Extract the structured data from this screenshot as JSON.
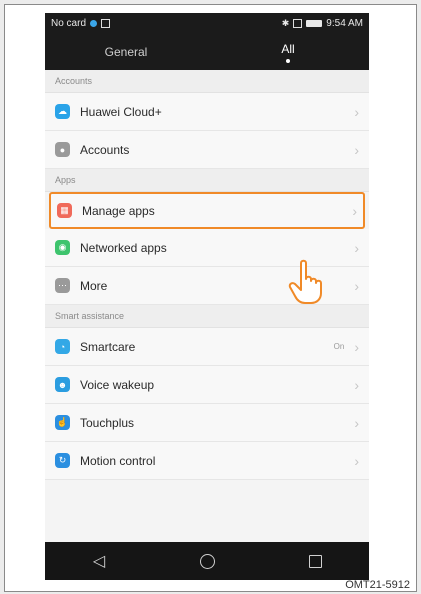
{
  "status_bar": {
    "left_text": "No card",
    "time": "9:54 AM",
    "icons": [
      "sim-icon",
      "bluetooth-icon",
      "battery-icon"
    ]
  },
  "tabs": [
    {
      "label": "General",
      "selected": false
    },
    {
      "label": "All",
      "selected": true
    }
  ],
  "sections": {
    "accounts": {
      "header": "Accounts",
      "items": [
        {
          "label": "Huawei Cloud+",
          "icon": "cloud-icon",
          "icon_color": "#2aa3e8"
        },
        {
          "label": "Accounts",
          "icon": "account-icon",
          "icon_color": "#9a9a9a"
        }
      ]
    },
    "apps": {
      "header": "Apps",
      "items": [
        {
          "label": "Manage apps",
          "icon": "apps-grid-icon",
          "icon_color": "#f06a5a",
          "highlighted": true
        },
        {
          "label": "Networked apps",
          "icon": "network-icon",
          "icon_color": "#3ec46d"
        },
        {
          "label": "More",
          "icon": "more-icon",
          "icon_color": "#9a9a9a"
        }
      ]
    },
    "smart": {
      "header": "Smart assistance",
      "items": [
        {
          "label": "Smartcare",
          "icon": "smartcare-icon",
          "icon_color": "#33a8e6",
          "value": "On"
        },
        {
          "label": "Voice wakeup",
          "icon": "voice-icon",
          "icon_color": "#2b9de0"
        },
        {
          "label": "Touchplus",
          "icon": "touch-icon",
          "icon_color": "#2b8fe0"
        },
        {
          "label": "Motion control",
          "icon": "motion-icon",
          "icon_color": "#2b8fe0"
        }
      ]
    }
  },
  "nav": {
    "icons": [
      "back-icon",
      "home-icon",
      "recents-icon"
    ]
  },
  "caption": "OMT21-5912",
  "accent_color": "#f08a28"
}
